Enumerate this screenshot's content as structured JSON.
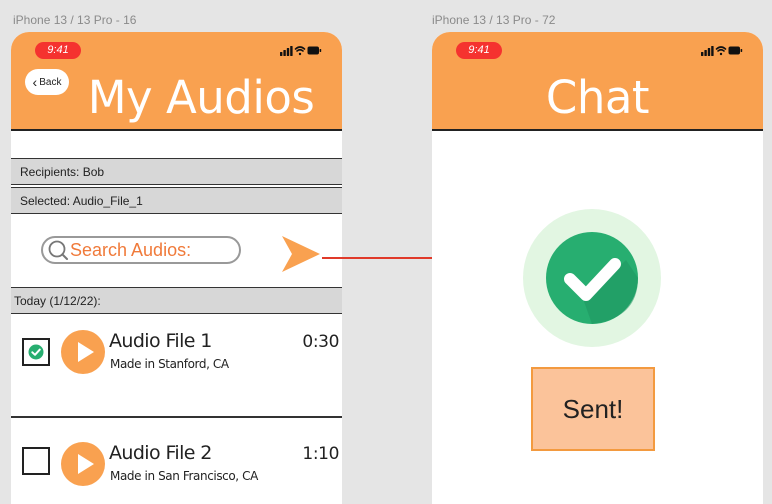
{
  "frames": [
    {
      "label": "iPhone 13 / 13 Pro - 16",
      "status_time": "9:41",
      "back_label": "Back",
      "title": "My Audios",
      "recipients": "Recipients: Bob",
      "selected": "Selected: Audio_File_1",
      "search_placeholder": "Search Audios:",
      "section_label": "Today (1/12/22):",
      "audio_items": [
        {
          "name": "Audio File 1",
          "location": "Made in Stanford, CA",
          "duration": "0:30",
          "checked": true
        },
        {
          "name": "Audio File 2",
          "location": "Made in San Francisco, CA",
          "duration": "1:10",
          "checked": false
        }
      ]
    },
    {
      "label": "iPhone 13 / 13 Pro - 72",
      "status_time": "9:41",
      "title": "Chat",
      "sent_label": "Sent!"
    }
  ],
  "colors": {
    "header": "#f9a150",
    "time_pill": "#f5322f",
    "search_text": "#f07a3a",
    "send_arrow": "#f9a150",
    "success_green": "#27ae70",
    "flow_arrow": "#e03a2a"
  },
  "icons": {
    "status": [
      "signal-icon",
      "wifi-icon",
      "battery-icon"
    ],
    "send": "send-arrow-icon",
    "search": "magnifier-icon",
    "play": "play-icon",
    "success": "checkmark-circle-icon"
  }
}
